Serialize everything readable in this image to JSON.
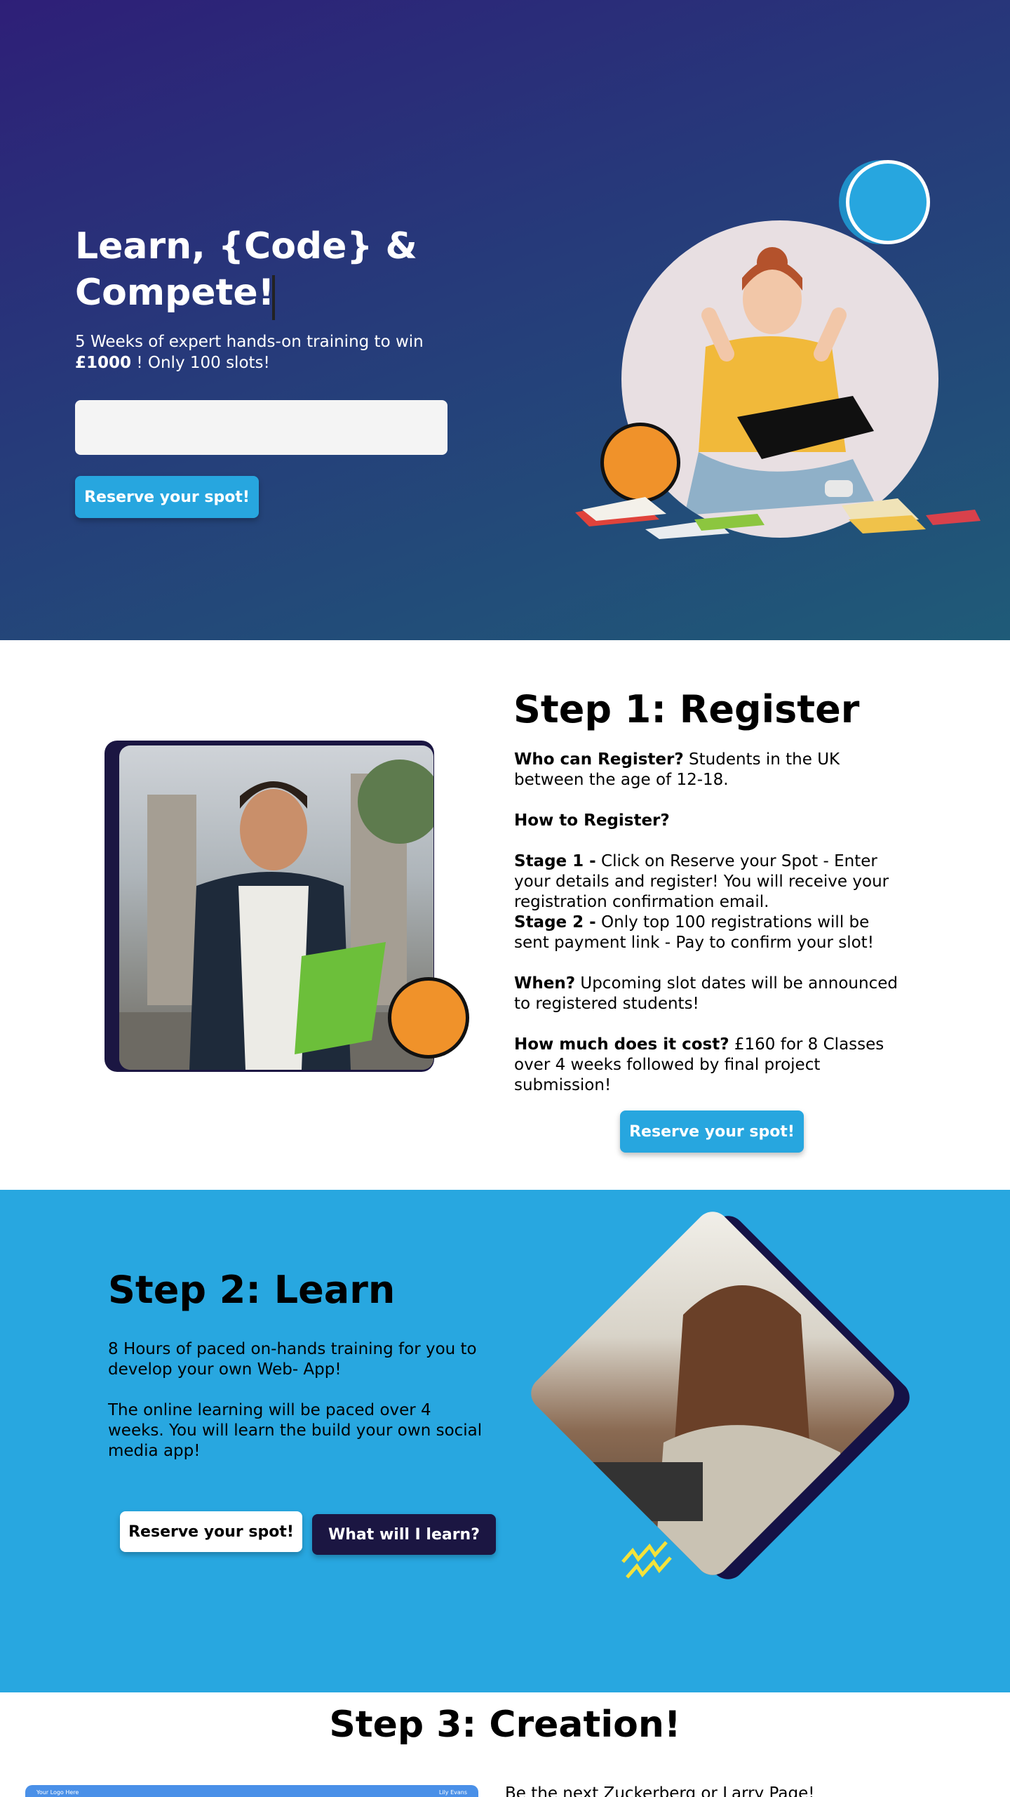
{
  "colors": {
    "hero_gradient_start": "#2e1f78",
    "hero_gradient_end": "#1f5b78",
    "accent_blue": "#27a6df",
    "accent_orange": "#f0922a",
    "navy": "#1b1642",
    "step2_background": "#28a7e0"
  },
  "hero": {
    "title": "Learn, {Code} & Compete!",
    "subtitle_start": "5 Weeks of expert hands-on training to win",
    "subtitle_amount": "£1000",
    "subtitle_end": " ! Only 100 slots!",
    "input_value": "",
    "cta_label": "Reserve your spot!"
  },
  "step1": {
    "heading": "Step 1: Register",
    "who_label": "Who can Register?",
    "who_text": " Students in the UK between the age of 12-18.",
    "how_label": "How to Register?",
    "stage1_label": "Stage 1 -",
    "stage1_text": " Click on Reserve your Spot - Enter your details and register! You will receive your registration confirmation email.",
    "stage2_label": "Stage 2 -",
    "stage2_text": " Only top 100 registrations will be sent payment link - Pay to confirm your slot!",
    "when_label": "When?",
    "when_text": " Upcoming slot dates will be announced to registered students!",
    "cost_label": "How much does it cost?",
    "cost_text": " £160 for 8 Classes over 4 weeks followed by final project submission!",
    "cta_label": "Reserve your spot!"
  },
  "step2": {
    "heading": "Step 2: Learn",
    "para1": "8 Hours of paced on-hands training for you to develop your own Web- App!",
    "para2": "The online learning will be paced over 4 weeks. You will learn the build your own social media app!",
    "cta_label": "Reserve your spot!",
    "secondary_label": "What will I learn?"
  },
  "step3": {
    "heading": "Step 3: Creation!",
    "card_left_text": "Your Logo Here",
    "card_right_text": "Lily Evans",
    "intro_text": "Be the next Zuckerberg or Larry Page!"
  }
}
